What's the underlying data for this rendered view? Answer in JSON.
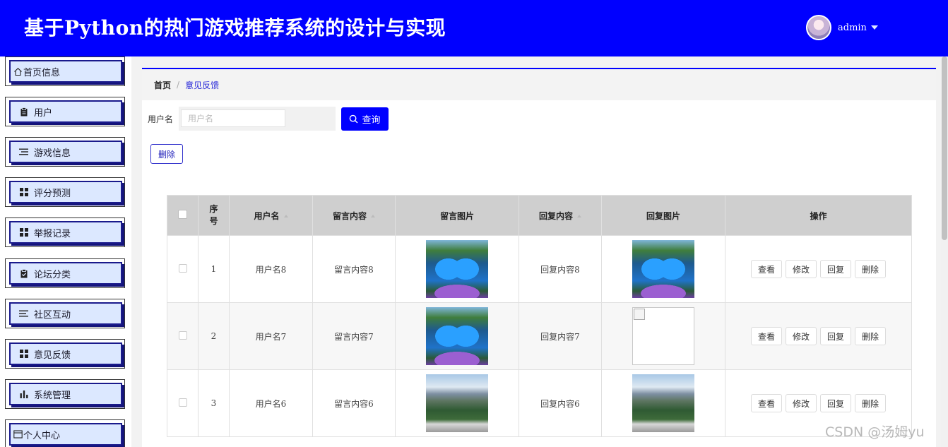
{
  "header": {
    "title": "基于Python的热门游戏推荐系统的设计与实现",
    "username": "admin",
    "colors": {
      "background": "#0000ff"
    }
  },
  "sidebar": {
    "items": [
      {
        "label": "首页信息",
        "icon": "home-icon"
      },
      {
        "label": "用户",
        "icon": "clipboard-icon"
      },
      {
        "label": "游戏信息",
        "icon": "list-icon"
      },
      {
        "label": "评分预测",
        "icon": "grid-icon"
      },
      {
        "label": "举报记录",
        "icon": "grid-icon"
      },
      {
        "label": "论坛分类",
        "icon": "clipboard-check-icon"
      },
      {
        "label": "社区互动",
        "icon": "list-icon"
      },
      {
        "label": "意见反馈",
        "icon": "grid-icon"
      },
      {
        "label": "系统管理",
        "icon": "bar-chart-icon"
      },
      {
        "label": "个人中心",
        "icon": "window-icon"
      }
    ]
  },
  "breadcrumb": {
    "home": "首页",
    "separator": "/",
    "current": "意见反馈"
  },
  "search": {
    "label": "用户名",
    "placeholder": "用户名",
    "value": "",
    "button_label": "查询"
  },
  "toolbar": {
    "delete_label": "删除"
  },
  "table": {
    "columns": [
      "序号",
      "用户名",
      "留言内容",
      "留言图片",
      "回复内容",
      "回复图片",
      "操作"
    ],
    "rows": [
      {
        "index": "1",
        "username": "用户名8",
        "message": "留言内容8",
        "message_image": "heart-lake",
        "reply": "回复内容8",
        "reply_image": "heart-lake"
      },
      {
        "index": "2",
        "username": "用户名7",
        "message": "留言内容7",
        "message_image": "heart-lake",
        "reply": "回复内容7",
        "reply_image": "broken"
      },
      {
        "index": "3",
        "username": "用户名6",
        "message": "留言内容6",
        "message_image": "snow-mountain",
        "reply": "回复内容6",
        "reply_image": "snow-mountain"
      }
    ],
    "actions": {
      "view": "查看",
      "edit": "修改",
      "reply": "回复",
      "delete": "删除"
    }
  },
  "watermark": "CSDN @汤姆yu"
}
